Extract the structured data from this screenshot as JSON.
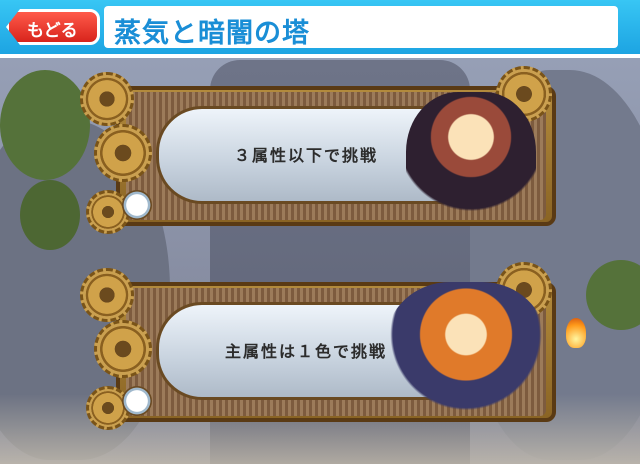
{
  "header": {
    "back_label": "もどる",
    "title": "蒸気と暗闇の塔"
  },
  "panels": [
    {
      "label": "３属性以下で挑戦",
      "character": "cat-hat-girl"
    },
    {
      "label": "主属性は１色で挑戦",
      "character": "top-hat-girl"
    }
  ],
  "icons": [
    "gear-icon",
    "pressure-gauge-icon",
    "flame-icon"
  ],
  "colors": {
    "header_blue": "#1da4e2",
    "back_button_red": "#d8241c",
    "title_text": "#1a8ed6",
    "frame_brass": "#b28a3c"
  }
}
